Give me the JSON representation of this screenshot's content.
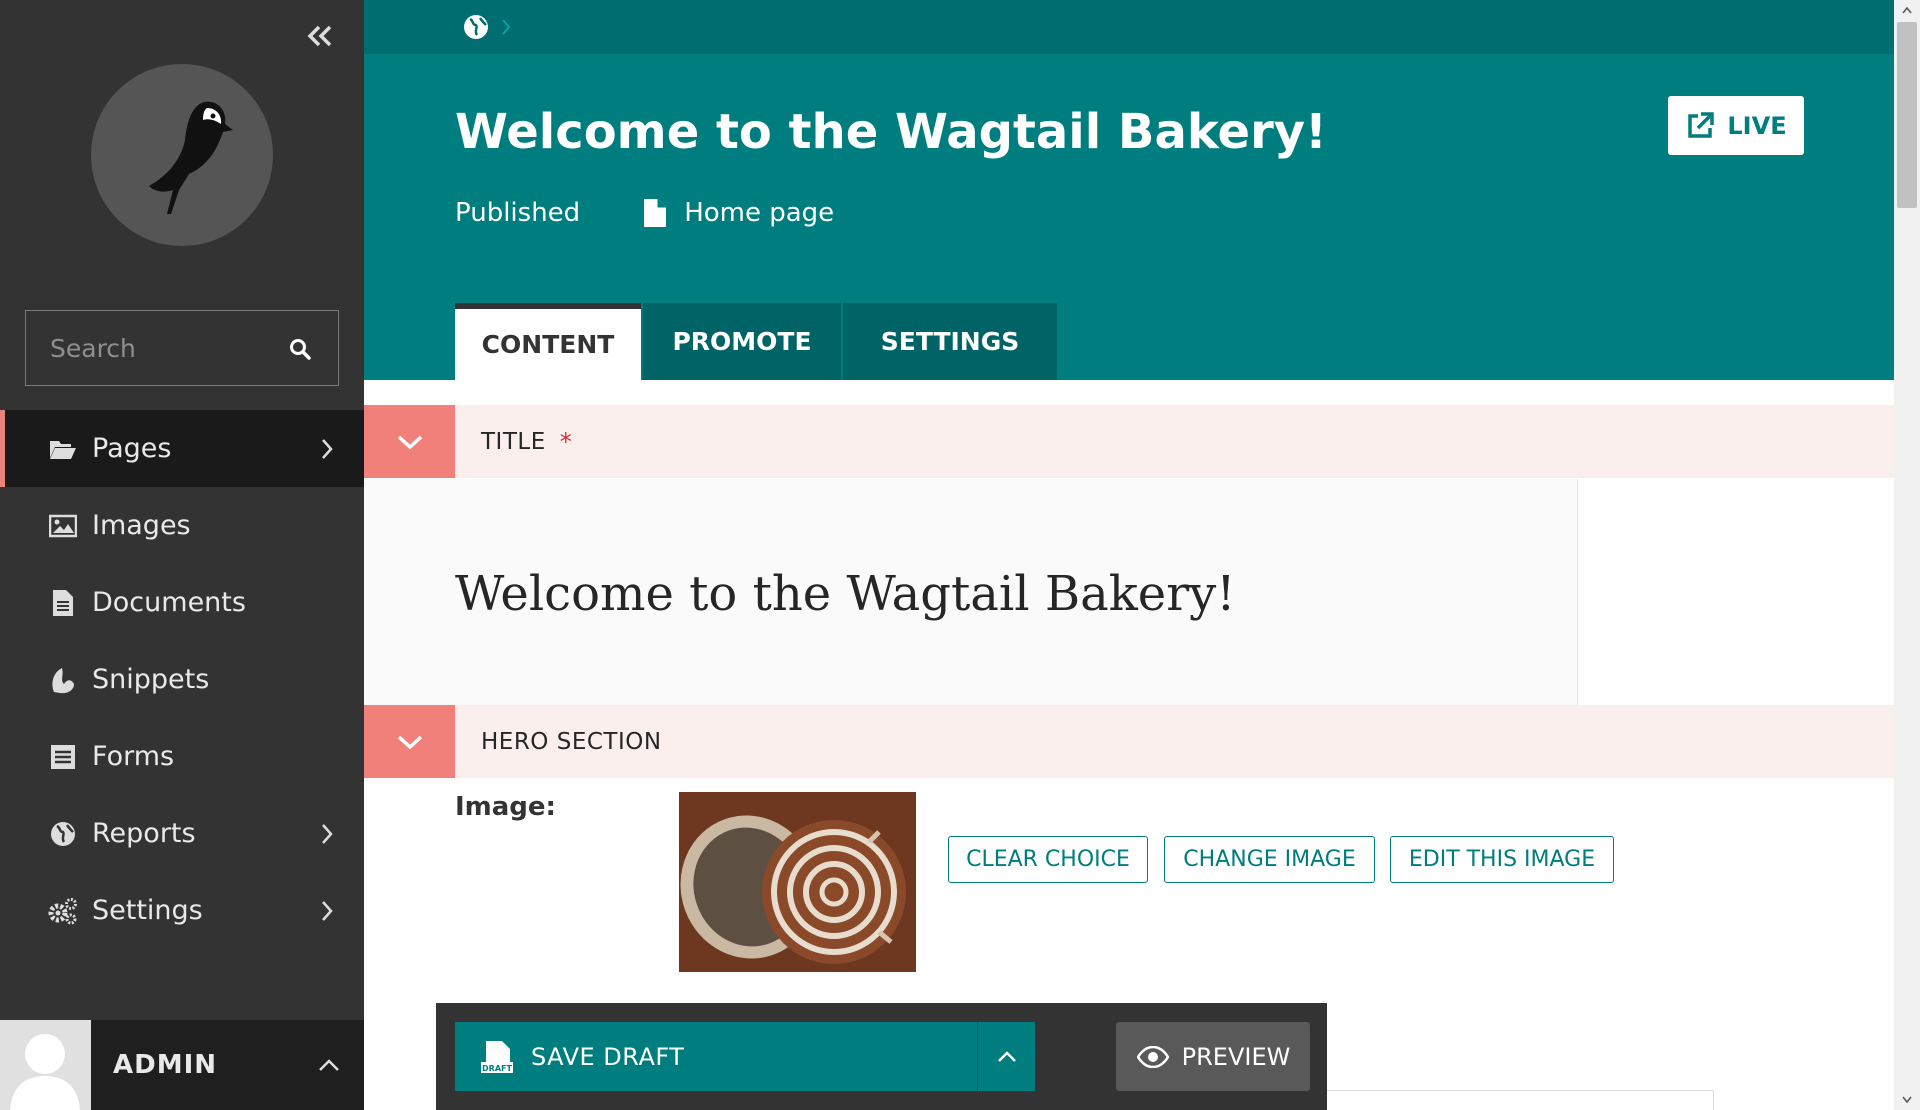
{
  "sidebar": {
    "search_placeholder": "Search",
    "items": [
      {
        "label": "Pages",
        "icon": "folder-open-icon",
        "has_submenu": true,
        "active": true
      },
      {
        "label": "Images",
        "icon": "image-icon",
        "has_submenu": false
      },
      {
        "label": "Documents",
        "icon": "document-icon",
        "has_submenu": false
      },
      {
        "label": "Snippets",
        "icon": "snippet-icon",
        "has_submenu": false
      },
      {
        "label": "Forms",
        "icon": "form-icon",
        "has_submenu": false
      },
      {
        "label": "Reports",
        "icon": "globe-icon",
        "has_submenu": true
      },
      {
        "label": "Settings",
        "icon": "cogs-icon",
        "has_submenu": true
      }
    ],
    "account_name": "ADMIN"
  },
  "header": {
    "title": "Welcome to the Wagtail Bakery!",
    "status": "Published",
    "page_type": "Home page",
    "live_label": "LIVE",
    "tabs": [
      {
        "label": "CONTENT",
        "active": true
      },
      {
        "label": "PROMOTE",
        "active": false
      },
      {
        "label": "SETTINGS",
        "active": false
      }
    ]
  },
  "main": {
    "title_section": {
      "label": "TITLE",
      "required_mark": "*",
      "value": "Welcome to the Wagtail Bakery!"
    },
    "hero_section": {
      "label": "HERO SECTION"
    },
    "image_field": {
      "label": "Image:",
      "clear_label": "CLEAR CHOICE",
      "change_label": "CHANGE IMAGE",
      "edit_label": "EDIT THIS IMAGE"
    }
  },
  "footer": {
    "save_label": "SAVE DRAFT",
    "save_icon_text": "DRAFT",
    "preview_label": "PREVIEW"
  },
  "colors": {
    "teal": "#007d7e",
    "dark_teal": "#006e70",
    "sidebar_bg": "#333333",
    "section_toggle": "#f2807a",
    "section_bg": "#fbefee",
    "required": "#cd3238"
  }
}
